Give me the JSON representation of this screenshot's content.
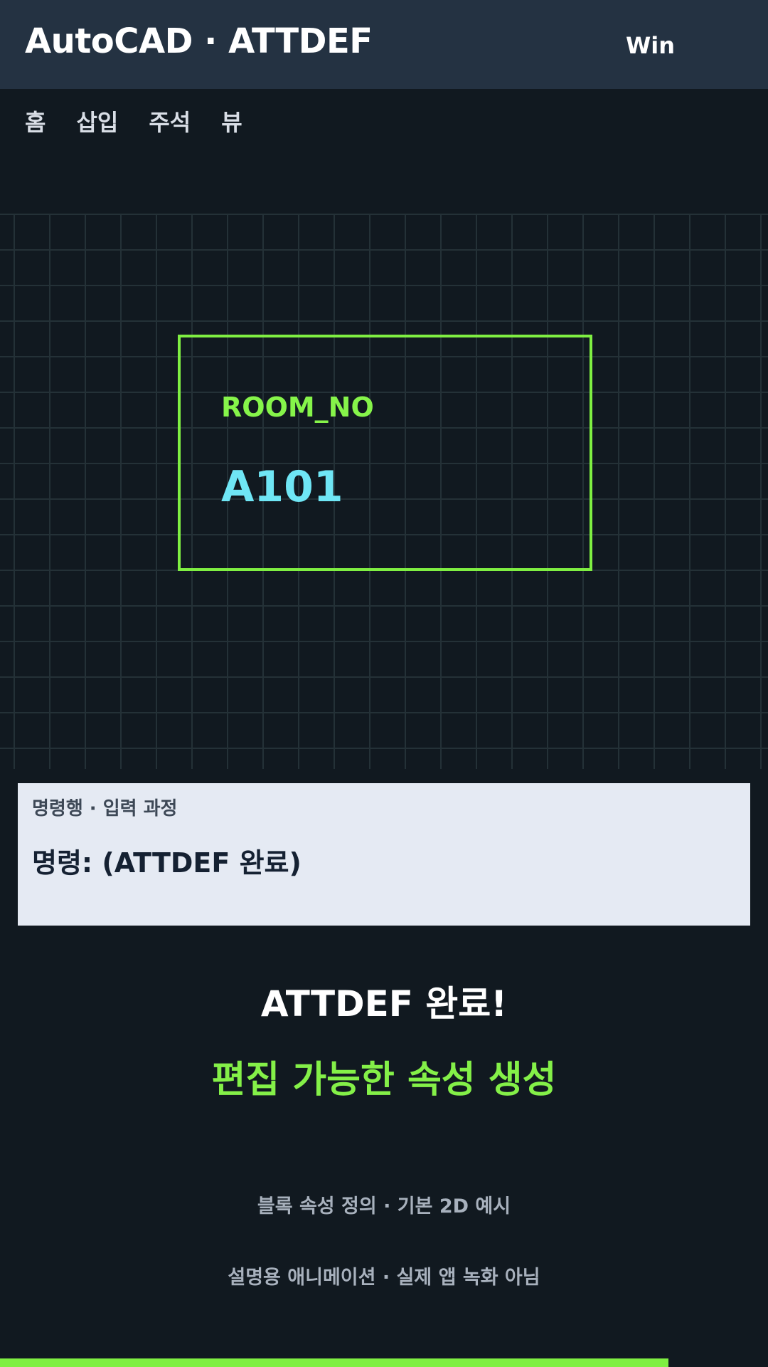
{
  "header": {
    "title": "AutoCAD · ATTDEF",
    "platform": "Win"
  },
  "ribbon": {
    "tabs": [
      {
        "label": "홈"
      },
      {
        "label": "삽입"
      },
      {
        "label": "주석"
      },
      {
        "label": "뷰"
      }
    ]
  },
  "drawing": {
    "attribute_tag": "ROOM_NO",
    "attribute_value": "A101"
  },
  "command_panel": {
    "label": "명령행 · 입력 과정",
    "line": "명령: (ATTDEF 완료)"
  },
  "result": {
    "title": "ATTDEF 완료!",
    "subtitle": "편집 가능한 속성 생성"
  },
  "notes": {
    "line1": "블록 속성 정의 · 기본 2D 예시",
    "line2": "설명용 애니메이션 · 실제 앱 녹화 아님"
  },
  "progress": {
    "fraction": 0.87
  },
  "colors": {
    "header_bg": "#243242",
    "background": "#111920",
    "accent_green": "#7fef42",
    "attribute_value": "#6fe6f5",
    "command_panel_bg": "#e5eaf3"
  }
}
